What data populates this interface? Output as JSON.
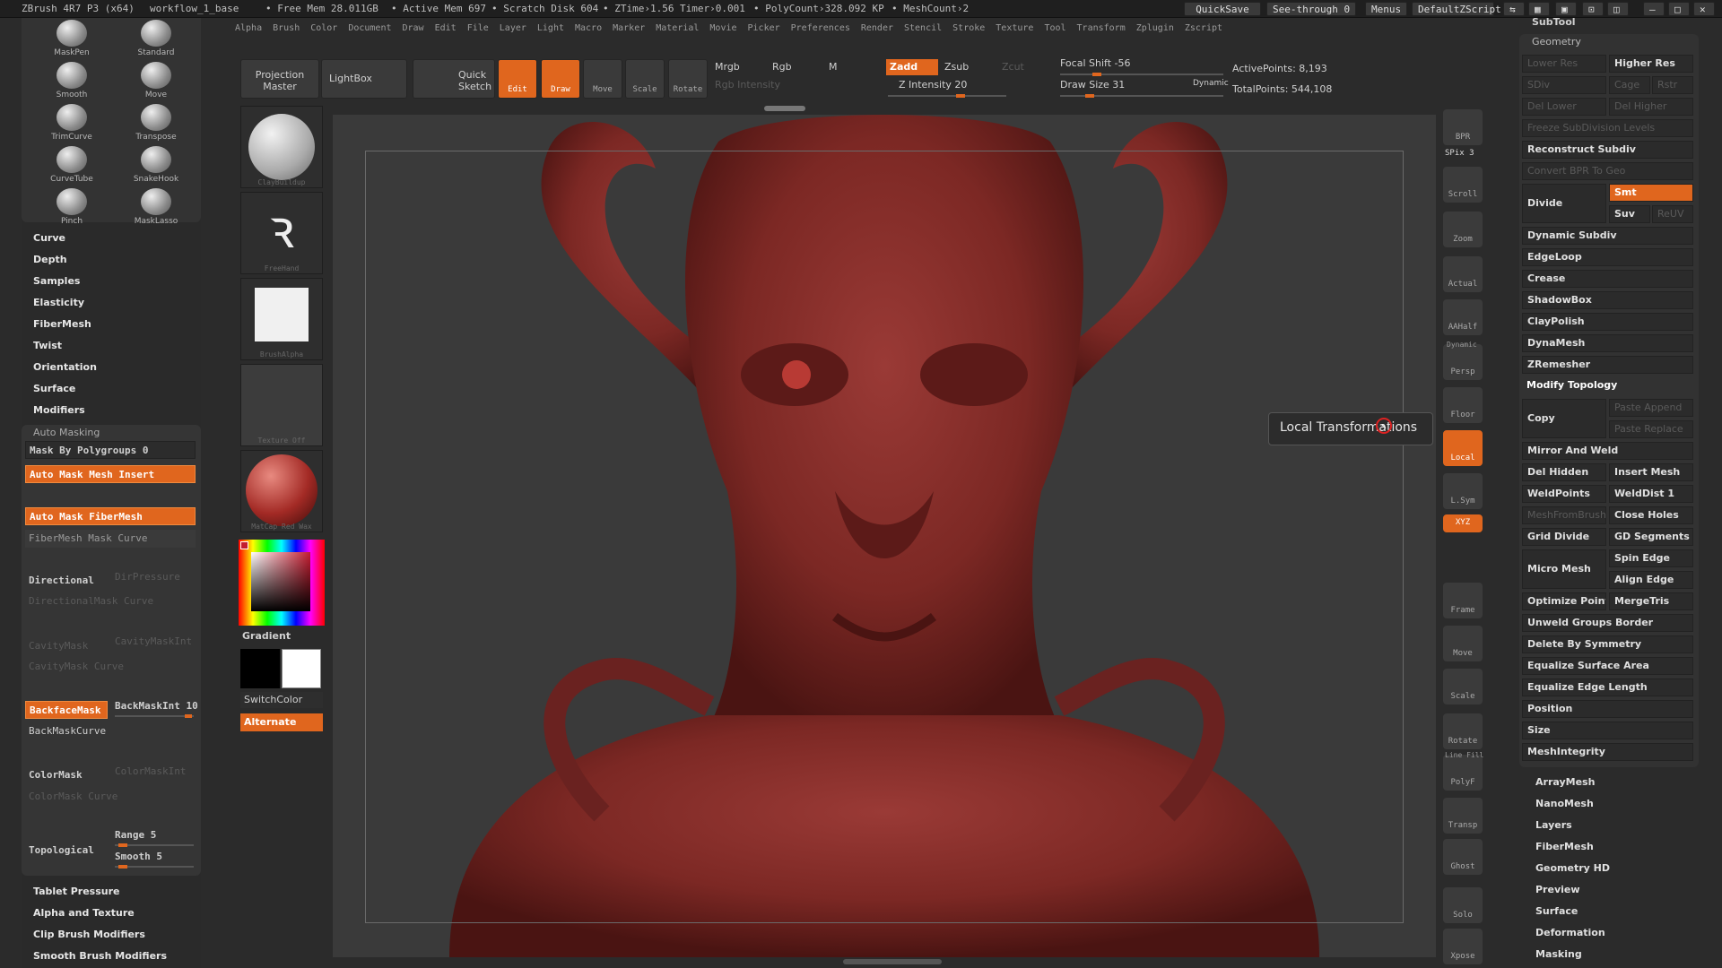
{
  "titlebar": {
    "app": "ZBrush 4R7 P3 (x64)",
    "doc": "workflow_1_base",
    "free_mem": "• Free Mem 28.011GB",
    "active_mem": "• Active Mem 697",
    "scratch": "• Scratch Disk 604",
    "ztime": "• ZTime›1.56",
    "timer": "Timer›0.001",
    "polycount": "• PolyCount›328.092 KP",
    "meshcount": "• MeshCount›2",
    "quicksave": "QuickSave",
    "seethrough": "See-through  0",
    "menus": "Menus",
    "script": "DefaultZScript"
  },
  "menubar": [
    "Alpha",
    "Brush",
    "Color",
    "Document",
    "Draw",
    "Edit",
    "File",
    "Layer",
    "Light",
    "Macro",
    "Marker",
    "Material",
    "Movie",
    "Picker",
    "Preferences",
    "Render",
    "Stencil",
    "Stroke",
    "Texture",
    "Tool",
    "Transform",
    "Zplugin",
    "Zscript"
  ],
  "brushes": [
    {
      "label": "MaskPen"
    },
    {
      "label": "Standard"
    },
    {
      "label": "Smooth"
    },
    {
      "label": "Move"
    },
    {
      "label": "TrimCurve"
    },
    {
      "label": "Transpose"
    },
    {
      "label": "CurveTube"
    },
    {
      "label": "SnakeHook"
    },
    {
      "label": "Pinch"
    },
    {
      "label": "MaskLasso"
    }
  ],
  "left_sections": [
    "Curve",
    "Depth",
    "Samples",
    "Elasticity",
    "FiberMesh",
    "Twist",
    "Orientation",
    "Surface",
    "Modifiers"
  ],
  "automask": {
    "title": "Auto Masking",
    "mask_by_polygroups": "Mask By Polygroups 0",
    "mesh_insert": "Auto Mask Mesh Insert",
    "fibermesh": "Auto Mask FiberMesh",
    "fibermesh_curve": "FiberMesh Mask Curve",
    "directional": "Directional",
    "dirpressure": "DirPressure",
    "dircurve": "DirectionalMask Curve",
    "cavitymask": "CavityMask",
    "cavityint": "CavityMaskInt",
    "cavitycurve": "CavityMask Curve",
    "backface": "BackfaceMask",
    "backint": "BackMaskInt 10",
    "backcurve": "BackMaskCurve",
    "colormask": "ColorMask",
    "colorint": "ColorMaskInt",
    "colorcurve": "ColorMask Curve",
    "topological": "Topological",
    "range": "Range 5",
    "smooth": "Smooth 5"
  },
  "left_bottom": [
    "Tablet Pressure",
    "Alpha and Texture",
    "Clip Brush Modifiers",
    "Smooth Brush Modifiers"
  ],
  "mid": {
    "projection": "Projection Master",
    "lightbox": "LightBox",
    "quicksketch": "Quick Sketch",
    "claybuildup": "ClayBuildup",
    "freehand": "FreeHand",
    "brushalpha": "BrushAlpha",
    "texture": "Texture Off",
    "matcap": "MatCap Red Wax",
    "gradient": "Gradient",
    "switchcolor": "SwitchColor",
    "alternate": "Alternate"
  },
  "toolbar": {
    "edit": "Edit",
    "draw": "Draw",
    "move": "Move",
    "scale": "Scale",
    "rotate": "Rotate",
    "mrgb": "Mrgb",
    "rgb": "Rgb",
    "m": "M",
    "rgb_intensity": "Rgb Intensity",
    "zadd": "Zadd",
    "zsub": "Zsub",
    "zcut": "Zcut",
    "z_intensity": "Z Intensity 20",
    "focal": "Focal Shift -56",
    "drawsize": "Draw Size 31",
    "dynamic": "Dynamic",
    "active_points": "ActivePoints: 8,193",
    "total_points": "TotalPoints: 544,108"
  },
  "right_tools": [
    {
      "label": "BPR"
    },
    {
      "label": "Scroll"
    },
    {
      "label": "Zoom"
    },
    {
      "label": "Actual"
    },
    {
      "label": "AAHalf"
    },
    {
      "label": "Persp"
    },
    {
      "label": "Floor"
    },
    {
      "label": "Local"
    },
    {
      "label": "L.Sym"
    },
    {
      "label": "XYZ"
    },
    {
      "label": "Frame"
    },
    {
      "label": "Move"
    },
    {
      "label": "Scale"
    },
    {
      "label": "Rotate"
    },
    {
      "label": "PolyF"
    },
    {
      "label": "Transp"
    },
    {
      "label": "Ghost"
    },
    {
      "label": "Solo"
    },
    {
      "label": "Xpose"
    }
  ],
  "spix": "SPix 3",
  "dynamic_label": "Dynamic",
  "linefill": "Line Fill",
  "tooltip": "Local Transformations",
  "right": {
    "subtool": "SubTool",
    "geometry": "Geometry",
    "lower_res": "Lower Res",
    "higher_res": "Higher Res",
    "sdiv": "SDiv",
    "cage": "Cage",
    "rstr": "Rstr",
    "del_lower": "Del Lower",
    "del_higher": "Del Higher",
    "freeze": "Freeze SubDivision Levels",
    "reconstruct": "Reconstruct Subdiv",
    "convert": "Convert BPR To Geo",
    "divide": "Divide",
    "smt": "Smt",
    "suv": "Suv",
    "reuv": "ReUV",
    "dynamic_subdiv": "Dynamic Subdiv",
    "edgeloop": "EdgeLoop",
    "crease": "Crease",
    "shadowbox": "ShadowBox",
    "claypolish": "ClayPolish",
    "dynamesh": "DynaMesh",
    "zremesher": "ZRemesher",
    "modify_topology": "Modify Topology",
    "copy": "Copy",
    "paste_append": "Paste Append",
    "paste_replace": "Paste Replace",
    "mirror_weld": "Mirror And Weld",
    "del_hidden": "Del Hidden",
    "insert_mesh": "Insert Mesh",
    "weldpoints": "WeldPoints",
    "welddist": "WeldDist 1",
    "meshfrombrush": "MeshFromBrush",
    "close_holes": "Close Holes",
    "grid_divide": "Grid Divide",
    "gd_segments": "GD Segments",
    "spin_edge": "Spin Edge",
    "micro_mesh": "Micro Mesh",
    "align_edge": "Align Edge",
    "optimize_points": "Optimize Points",
    "mergetris": "MergeTris",
    "unweld": "Unweld Groups Border",
    "delete_symmetry": "Delete By Symmetry",
    "equalize_surface": "Equalize Surface Area",
    "equalize_edge": "Equalize Edge Length",
    "position": "Position",
    "size": "Size",
    "meshintegrity": "MeshIntegrity"
  },
  "right_bottom": [
    "ArrayMesh",
    "NanoMesh",
    "Layers",
    "FiberMesh",
    "Geometry HD",
    "Preview",
    "Surface",
    "Deformation",
    "Masking"
  ]
}
